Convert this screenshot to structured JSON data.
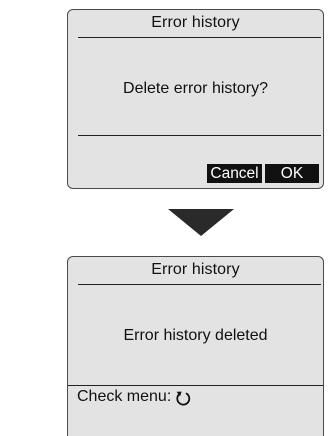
{
  "screen1": {
    "title": "Error history",
    "message": "Delete error history?",
    "buttons": {
      "cancel": "Cancel",
      "ok": "OK"
    }
  },
  "transition": {
    "icon": "down-arrow-icon"
  },
  "screen2": {
    "title": "Error history",
    "message": "Error history deleted",
    "footer_label": "Check menu:",
    "footer_icon": "return-icon"
  }
}
